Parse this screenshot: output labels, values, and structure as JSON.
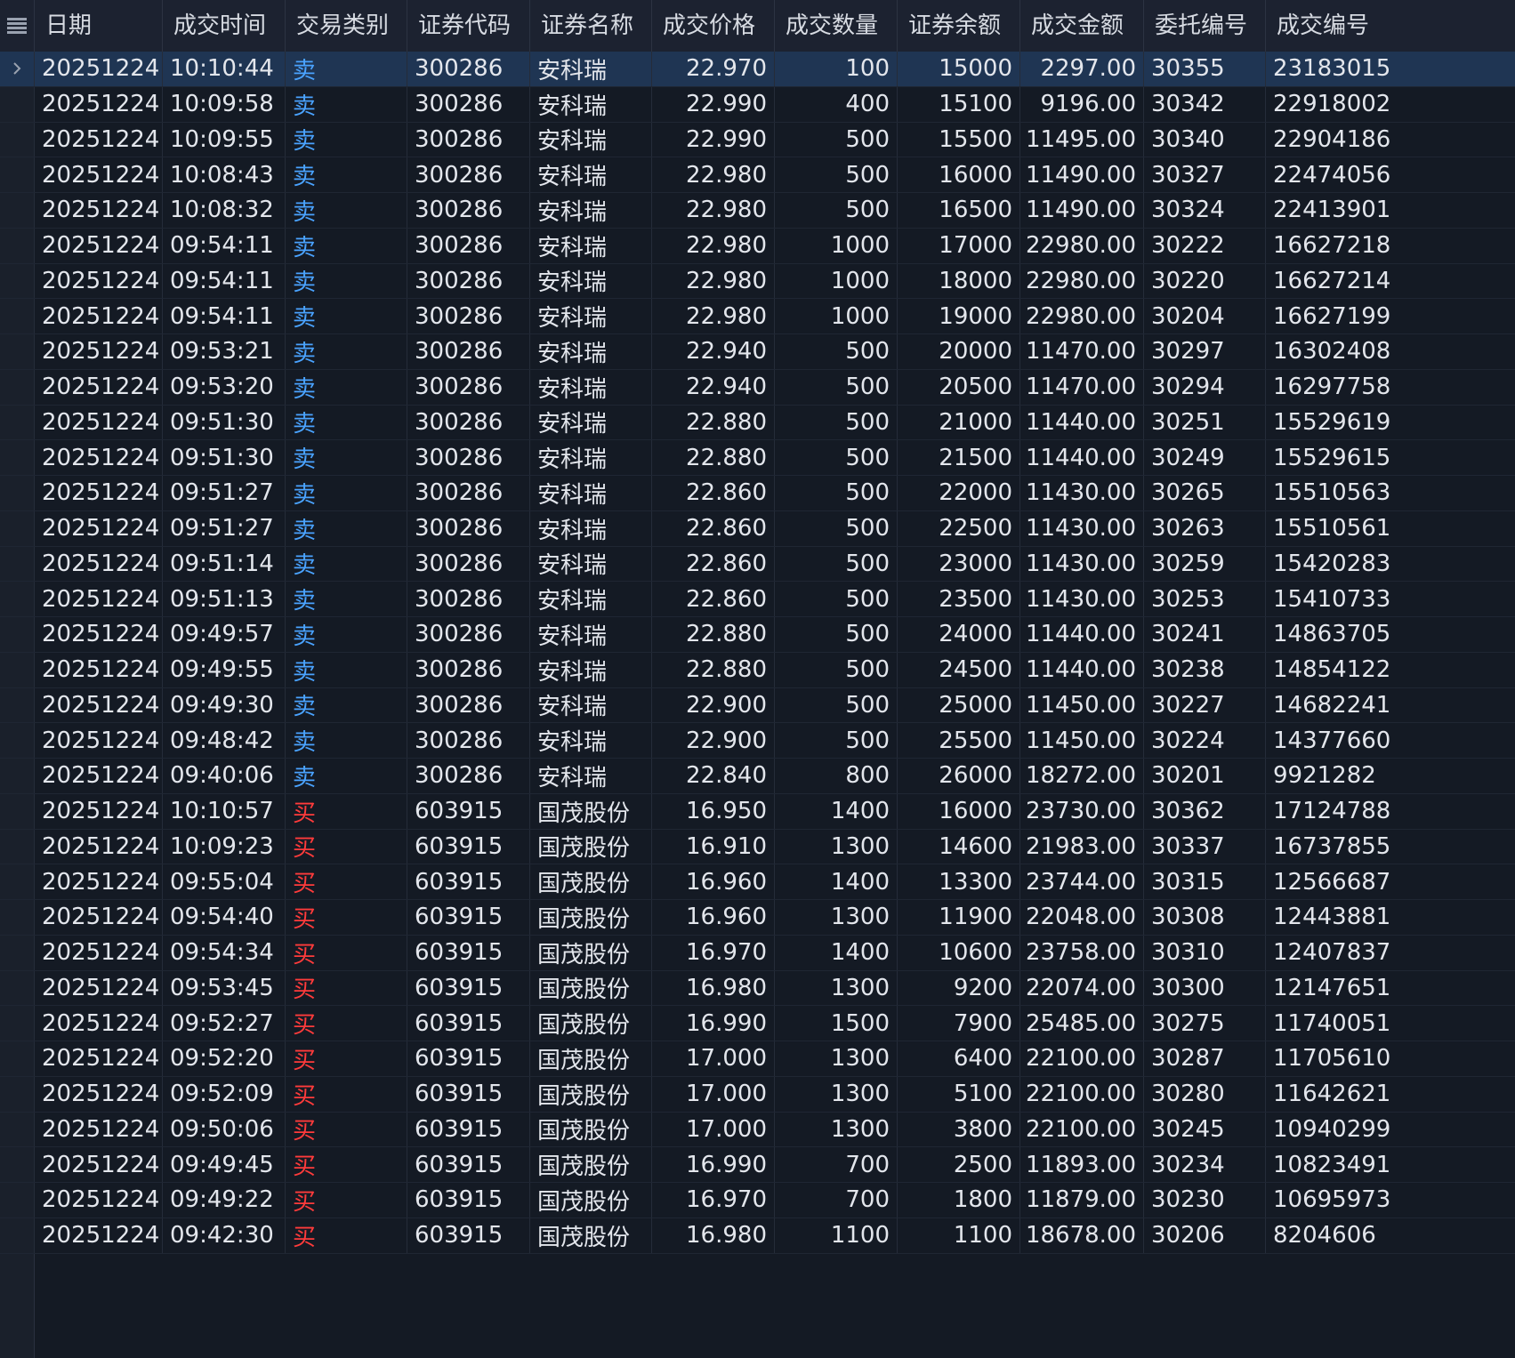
{
  "columns": [
    "日期",
    "成交时间",
    "交易类别",
    "证券代码",
    "证券名称",
    "成交价格",
    "成交数量",
    "证券余额",
    "成交金额",
    "委托编号",
    "成交编号"
  ],
  "colors": {
    "sell": "#4aa3ff",
    "buy": "#ff3b3b",
    "background": "#141a24",
    "header": "#1c2230",
    "selected": "#1f3553"
  },
  "icons": {
    "menu": "hamburger-icon",
    "current_row": "chevron-right-icon"
  },
  "selected_row": 0,
  "rows": [
    {
      "date": "20251224",
      "time": "10:10:44",
      "side": "卖",
      "code": "300286",
      "name": "安科瑞",
      "price": "22.970",
      "qty": "100",
      "balance": "15000",
      "amount": "2297.00",
      "order": "30355",
      "trade": "23183015"
    },
    {
      "date": "20251224",
      "time": "10:09:58",
      "side": "卖",
      "code": "300286",
      "name": "安科瑞",
      "price": "22.990",
      "qty": "400",
      "balance": "15100",
      "amount": "9196.00",
      "order": "30342",
      "trade": "22918002"
    },
    {
      "date": "20251224",
      "time": "10:09:55",
      "side": "卖",
      "code": "300286",
      "name": "安科瑞",
      "price": "22.990",
      "qty": "500",
      "balance": "15500",
      "amount": "11495.00",
      "order": "30340",
      "trade": "22904186"
    },
    {
      "date": "20251224",
      "time": "10:08:43",
      "side": "卖",
      "code": "300286",
      "name": "安科瑞",
      "price": "22.980",
      "qty": "500",
      "balance": "16000",
      "amount": "11490.00",
      "order": "30327",
      "trade": "22474056"
    },
    {
      "date": "20251224",
      "time": "10:08:32",
      "side": "卖",
      "code": "300286",
      "name": "安科瑞",
      "price": "22.980",
      "qty": "500",
      "balance": "16500",
      "amount": "11490.00",
      "order": "30324",
      "trade": "22413901"
    },
    {
      "date": "20251224",
      "time": "09:54:11",
      "side": "卖",
      "code": "300286",
      "name": "安科瑞",
      "price": "22.980",
      "qty": "1000",
      "balance": "17000",
      "amount": "22980.00",
      "order": "30222",
      "trade": "16627218"
    },
    {
      "date": "20251224",
      "time": "09:54:11",
      "side": "卖",
      "code": "300286",
      "name": "安科瑞",
      "price": "22.980",
      "qty": "1000",
      "balance": "18000",
      "amount": "22980.00",
      "order": "30220",
      "trade": "16627214"
    },
    {
      "date": "20251224",
      "time": "09:54:11",
      "side": "卖",
      "code": "300286",
      "name": "安科瑞",
      "price": "22.980",
      "qty": "1000",
      "balance": "19000",
      "amount": "22980.00",
      "order": "30204",
      "trade": "16627199"
    },
    {
      "date": "20251224",
      "time": "09:53:21",
      "side": "卖",
      "code": "300286",
      "name": "安科瑞",
      "price": "22.940",
      "qty": "500",
      "balance": "20000",
      "amount": "11470.00",
      "order": "30297",
      "trade": "16302408"
    },
    {
      "date": "20251224",
      "time": "09:53:20",
      "side": "卖",
      "code": "300286",
      "name": "安科瑞",
      "price": "22.940",
      "qty": "500",
      "balance": "20500",
      "amount": "11470.00",
      "order": "30294",
      "trade": "16297758"
    },
    {
      "date": "20251224",
      "time": "09:51:30",
      "side": "卖",
      "code": "300286",
      "name": "安科瑞",
      "price": "22.880",
      "qty": "500",
      "balance": "21000",
      "amount": "11440.00",
      "order": "30251",
      "trade": "15529619"
    },
    {
      "date": "20251224",
      "time": "09:51:30",
      "side": "卖",
      "code": "300286",
      "name": "安科瑞",
      "price": "22.880",
      "qty": "500",
      "balance": "21500",
      "amount": "11440.00",
      "order": "30249",
      "trade": "15529615"
    },
    {
      "date": "20251224",
      "time": "09:51:27",
      "side": "卖",
      "code": "300286",
      "name": "安科瑞",
      "price": "22.860",
      "qty": "500",
      "balance": "22000",
      "amount": "11430.00",
      "order": "30265",
      "trade": "15510563"
    },
    {
      "date": "20251224",
      "time": "09:51:27",
      "side": "卖",
      "code": "300286",
      "name": "安科瑞",
      "price": "22.860",
      "qty": "500",
      "balance": "22500",
      "amount": "11430.00",
      "order": "30263",
      "trade": "15510561"
    },
    {
      "date": "20251224",
      "time": "09:51:14",
      "side": "卖",
      "code": "300286",
      "name": "安科瑞",
      "price": "22.860",
      "qty": "500",
      "balance": "23000",
      "amount": "11430.00",
      "order": "30259",
      "trade": "15420283"
    },
    {
      "date": "20251224",
      "time": "09:51:13",
      "side": "卖",
      "code": "300286",
      "name": "安科瑞",
      "price": "22.860",
      "qty": "500",
      "balance": "23500",
      "amount": "11430.00",
      "order": "30253",
      "trade": "15410733"
    },
    {
      "date": "20251224",
      "time": "09:49:57",
      "side": "卖",
      "code": "300286",
      "name": "安科瑞",
      "price": "22.880",
      "qty": "500",
      "balance": "24000",
      "amount": "11440.00",
      "order": "30241",
      "trade": "14863705"
    },
    {
      "date": "20251224",
      "time": "09:49:55",
      "side": "卖",
      "code": "300286",
      "name": "安科瑞",
      "price": "22.880",
      "qty": "500",
      "balance": "24500",
      "amount": "11440.00",
      "order": "30238",
      "trade": "14854122"
    },
    {
      "date": "20251224",
      "time": "09:49:30",
      "side": "卖",
      "code": "300286",
      "name": "安科瑞",
      "price": "22.900",
      "qty": "500",
      "balance": "25000",
      "amount": "11450.00",
      "order": "30227",
      "trade": "14682241"
    },
    {
      "date": "20251224",
      "time": "09:48:42",
      "side": "卖",
      "code": "300286",
      "name": "安科瑞",
      "price": "22.900",
      "qty": "500",
      "balance": "25500",
      "amount": "11450.00",
      "order": "30224",
      "trade": "14377660"
    },
    {
      "date": "20251224",
      "time": "09:40:06",
      "side": "卖",
      "code": "300286",
      "name": "安科瑞",
      "price": "22.840",
      "qty": "800",
      "balance": "26000",
      "amount": "18272.00",
      "order": "30201",
      "trade": "9921282"
    },
    {
      "date": "20251224",
      "time": "10:10:57",
      "side": "买",
      "code": "603915",
      "name": "国茂股份",
      "price": "16.950",
      "qty": "1400",
      "balance": "16000",
      "amount": "23730.00",
      "order": "30362",
      "trade": "17124788"
    },
    {
      "date": "20251224",
      "time": "10:09:23",
      "side": "买",
      "code": "603915",
      "name": "国茂股份",
      "price": "16.910",
      "qty": "1300",
      "balance": "14600",
      "amount": "21983.00",
      "order": "30337",
      "trade": "16737855"
    },
    {
      "date": "20251224",
      "time": "09:55:04",
      "side": "买",
      "code": "603915",
      "name": "国茂股份",
      "price": "16.960",
      "qty": "1400",
      "balance": "13300",
      "amount": "23744.00",
      "order": "30315",
      "trade": "12566687"
    },
    {
      "date": "20251224",
      "time": "09:54:40",
      "side": "买",
      "code": "603915",
      "name": "国茂股份",
      "price": "16.960",
      "qty": "1300",
      "balance": "11900",
      "amount": "22048.00",
      "order": "30308",
      "trade": "12443881"
    },
    {
      "date": "20251224",
      "time": "09:54:34",
      "side": "买",
      "code": "603915",
      "name": "国茂股份",
      "price": "16.970",
      "qty": "1400",
      "balance": "10600",
      "amount": "23758.00",
      "order": "30310",
      "trade": "12407837"
    },
    {
      "date": "20251224",
      "time": "09:53:45",
      "side": "买",
      "code": "603915",
      "name": "国茂股份",
      "price": "16.980",
      "qty": "1300",
      "balance": "9200",
      "amount": "22074.00",
      "order": "30300",
      "trade": "12147651"
    },
    {
      "date": "20251224",
      "time": "09:52:27",
      "side": "买",
      "code": "603915",
      "name": "国茂股份",
      "price": "16.990",
      "qty": "1500",
      "balance": "7900",
      "amount": "25485.00",
      "order": "30275",
      "trade": "11740051"
    },
    {
      "date": "20251224",
      "time": "09:52:20",
      "side": "买",
      "code": "603915",
      "name": "国茂股份",
      "price": "17.000",
      "qty": "1300",
      "balance": "6400",
      "amount": "22100.00",
      "order": "30287",
      "trade": "11705610"
    },
    {
      "date": "20251224",
      "time": "09:52:09",
      "side": "买",
      "code": "603915",
      "name": "国茂股份",
      "price": "17.000",
      "qty": "1300",
      "balance": "5100",
      "amount": "22100.00",
      "order": "30280",
      "trade": "11642621"
    },
    {
      "date": "20251224",
      "time": "09:50:06",
      "side": "买",
      "code": "603915",
      "name": "国茂股份",
      "price": "17.000",
      "qty": "1300",
      "balance": "3800",
      "amount": "22100.00",
      "order": "30245",
      "trade": "10940299"
    },
    {
      "date": "20251224",
      "time": "09:49:45",
      "side": "买",
      "code": "603915",
      "name": "国茂股份",
      "price": "16.990",
      "qty": "700",
      "balance": "2500",
      "amount": "11893.00",
      "order": "30234",
      "trade": "10823491"
    },
    {
      "date": "20251224",
      "time": "09:49:22",
      "side": "买",
      "code": "603915",
      "name": "国茂股份",
      "price": "16.970",
      "qty": "700",
      "balance": "1800",
      "amount": "11879.00",
      "order": "30230",
      "trade": "10695973"
    },
    {
      "date": "20251224",
      "time": "09:42:30",
      "side": "买",
      "code": "603915",
      "name": "国茂股份",
      "price": "16.980",
      "qty": "1100",
      "balance": "1100",
      "amount": "18678.00",
      "order": "30206",
      "trade": "8204606"
    }
  ]
}
